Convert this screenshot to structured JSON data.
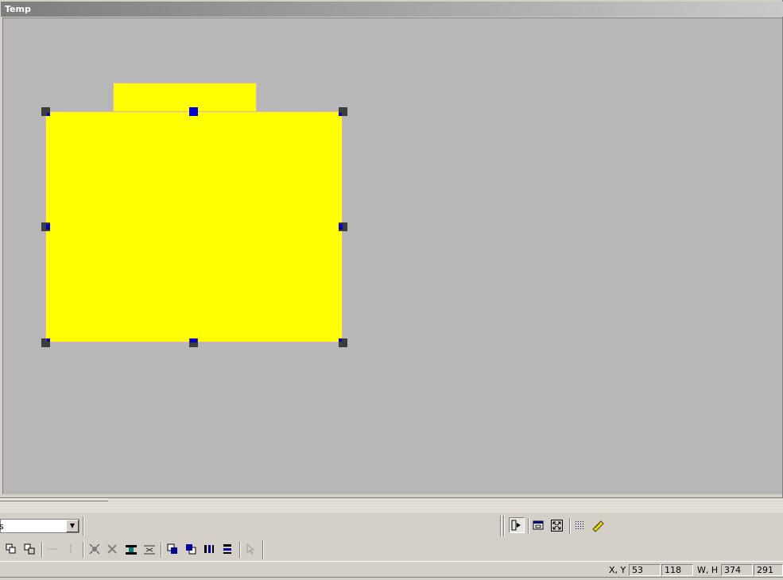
{
  "window": {
    "title": "Temp"
  },
  "canvas": {
    "background": "#b7b7b7",
    "shape_fill": "#ffff00",
    "shape_border": "#e8a8c8",
    "selection_handle_color": "#0000c8"
  },
  "toolbar": {
    "font_combo_value": "s",
    "row1_right_icons": [
      "pointer-select-icon",
      "window-icon",
      "fit-screen-icon",
      "grid-icon",
      "ruler-icon"
    ],
    "row2_icons": [
      "group-icon",
      "ungroup-icon",
      "horizontal-dots-icon",
      "vertical-dots-icon",
      "align-corners-icon",
      "align-center-icon",
      "distribute-h-icon",
      "distribute-v-icon",
      "bring-front-icon",
      "send-back-icon",
      "center-h-icon",
      "center-v-icon",
      "cursor-icon"
    ]
  },
  "status": {
    "xy_label": "X, Y",
    "x": "53",
    "y": "118",
    "wh_label": "W, H",
    "w": "374",
    "h": "291"
  }
}
